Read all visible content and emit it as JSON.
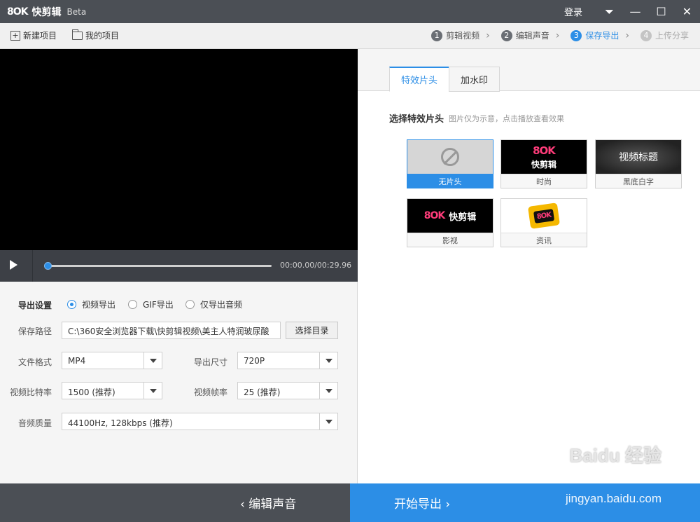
{
  "app": {
    "logo_mark": "8OK",
    "name": "快剪辑",
    "edition": "Beta",
    "login": "登录"
  },
  "window_controls": {
    "menu": "⏷",
    "minimize": "—",
    "maximize": "☐",
    "close": "✕"
  },
  "toolbar": {
    "new_project": "新建项目",
    "my_projects": "我的项目",
    "steps": [
      {
        "num": "1",
        "label": "剪辑视频",
        "state": "done"
      },
      {
        "num": "2",
        "label": "编辑声音",
        "state": "done"
      },
      {
        "num": "3",
        "label": "保存导出",
        "state": "active"
      },
      {
        "num": "4",
        "label": "上传分享",
        "state": "disabled"
      }
    ],
    "step_arrow": "›"
  },
  "player": {
    "time": "00:00.00/00:29.96",
    "progress": 0
  },
  "export": {
    "section_label": "导出设置",
    "modes": [
      {
        "label": "视频导出",
        "selected": true
      },
      {
        "label": "GIF导出",
        "selected": false
      },
      {
        "label": "仅导出音频",
        "selected": false
      }
    ],
    "save_path_label": "保存路径",
    "save_path_value": "C:\\360安全浏览器下载\\快剪辑视频\\美主人特润玻尿酸",
    "choose_dir": "选择目录",
    "format_label": "文件格式",
    "format_value": "MP4",
    "size_label": "导出尺寸",
    "size_value": "720P",
    "bitrate_label": "视频比特率",
    "bitrate_value": "1500 (推荐)",
    "fps_label": "视频帧率",
    "fps_value": "25 (推荐)",
    "audio_label": "音频质量",
    "audio_value": "44100Hz, 128kbps (推荐)"
  },
  "right_panel": {
    "tabs": [
      "特效片头",
      "加水印"
    ],
    "section_title": "选择特效片头",
    "hint": "图片仅为示意，点击播放查看效果",
    "cards": [
      {
        "caption": "无片头",
        "selected": true
      },
      {
        "caption": "时尚",
        "thumb_text_1": "8OK",
        "thumb_text_2": "快剪辑"
      },
      {
        "caption": "黑底白字",
        "thumb_text_1": "视频标题"
      },
      {
        "caption": "影视",
        "thumb_text_1": "8OK",
        "thumb_text_2": "快剪辑"
      },
      {
        "caption": "资讯",
        "thumb_text_1": "8OK"
      }
    ]
  },
  "bottom": {
    "back": "‹  编辑声音",
    "export": "开始导出  ›"
  },
  "watermark": {
    "line1": "Baidu 经验",
    "line2": "jingyan.baidu.com"
  },
  "colors": {
    "accent": "#2c8ee6",
    "titlebar": "#4b4f55",
    "pink": "#ff3c7a",
    "cyan": "#37d7e6"
  }
}
